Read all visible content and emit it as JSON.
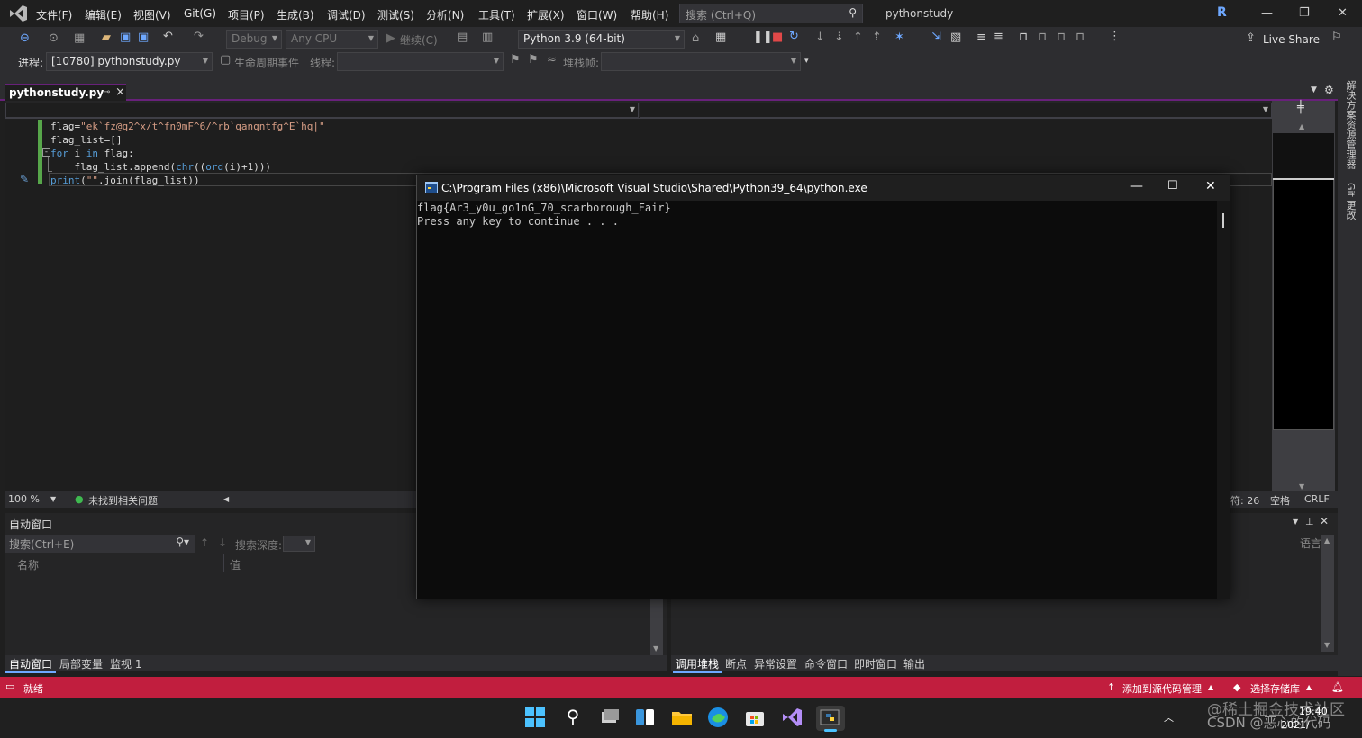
{
  "menu": {
    "items": [
      "文件(F)",
      "编辑(E)",
      "视图(V)",
      "Git(G)",
      "项目(P)",
      "生成(B)",
      "调试(D)",
      "测试(S)",
      "分析(N)",
      "工具(T)",
      "扩展(X)",
      "窗口(W)",
      "帮助(H)"
    ],
    "search_placeholder": "搜索 (Ctrl+Q)",
    "app_title": "pythonstudy",
    "account_initial": "R"
  },
  "toolbar": {
    "config": "Debug",
    "platform": "Any CPU",
    "continue_label": "继续(C)",
    "python_env": "Python 3.9 (64-bit)",
    "live_share": "Live Share"
  },
  "debug_bar": {
    "process_label": "进程:",
    "process_value": "[10780] pythonstudy.py",
    "lifecycle_label": "生命周期事件",
    "thread_label": "线程:",
    "stackframe_label": "堆栈帧:"
  },
  "editor": {
    "tab_name": "pythonstudy.py",
    "code": [
      "flag=\"ek`fz@q2^x/t^fn0mF^6/^rb`qanqntfg^E`hq|\"",
      "flag_list=[]",
      "for i in flag:",
      "    flag_list.append(chr((ord(i)+1)))",
      "print(\"\".join(flag_list))"
    ],
    "zoom": "100 %",
    "issues": "未找到相关问题",
    "char_pos": "符: 26",
    "whitespace": "空格",
    "line_ending": "CRLF"
  },
  "console": {
    "title": "C:\\Program Files (x86)\\Microsoft Visual Studio\\Shared\\Python39_64\\python.exe",
    "lines": [
      "flag{Ar3_y0u_go1nG_70_scarborough_Fair}",
      "Press any key to continue . . ."
    ]
  },
  "right_rail": {
    "solution_explorer": "解决方案资源管理器",
    "git_changes": "Git 更改"
  },
  "autos": {
    "title": "自动窗口",
    "search_placeholder": "搜索(Ctrl+E)",
    "search_depth": "搜索深度:",
    "col_name": "名称",
    "col_value": "值",
    "tabs": [
      "自动窗口",
      "局部变量",
      "监视 1"
    ]
  },
  "callstack": {
    "col_language": "语言",
    "tabs": [
      "调用堆栈",
      "断点",
      "异常设置",
      "命令窗口",
      "即时窗口",
      "输出"
    ]
  },
  "statusbar": {
    "ready": "就绪",
    "add_source_control": "添加到源代码管理",
    "select_repo": "选择存储库"
  },
  "taskbar": {
    "time": "19:40",
    "date": "2021/"
  },
  "watermark": {
    "line1": "@稀土掘金技术社区",
    "line2": "CSDN @恶心的代码"
  },
  "colors": {
    "status_bar": "#c11e3e",
    "accent": "#68217a",
    "green_change": "#57a64a"
  }
}
